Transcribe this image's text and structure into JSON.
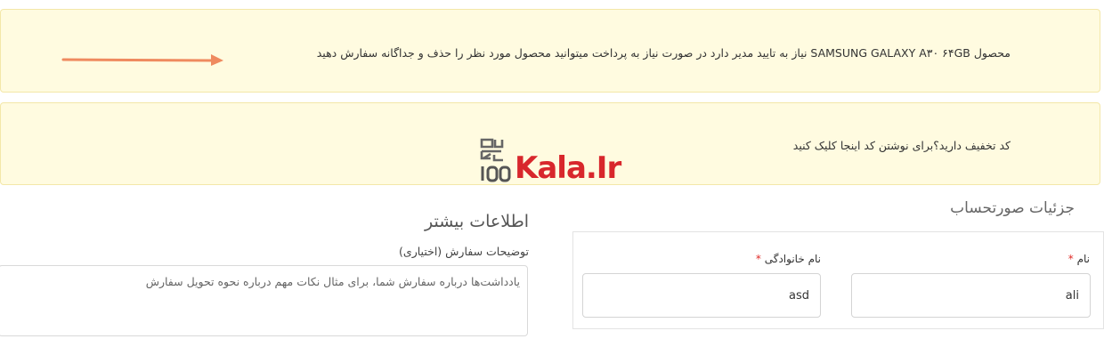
{
  "notices": {
    "approval": "محصول SAMSUNG GALAXY A۳۰ ۶۴GB نیاز به تایید مدیر دارد در صورت نیاز به پرداخت میتوانید محصول مورد نظر را حذف و جداگانه سفارش دهید",
    "coupon_question": "کد تخفیف دارید؟",
    "coupon_link": "برای نوشتن کد اینجا کلیک کنید"
  },
  "logo": {
    "top_mark": "صد کالا",
    "number": "100",
    "word": "Kala.Ir",
    "brand_color": "#d8272c"
  },
  "billing": {
    "title": "جزئیات صورتحساب",
    "first_name_label": "نام",
    "last_name_label": "نام خانوادگی",
    "required_mark": "*",
    "first_name_value": "ali",
    "last_name_value": "asd"
  },
  "additional": {
    "title": "اطلاعات بیشتر",
    "notes_label": "توضیحات سفارش (اختیاری)",
    "notes_placeholder": "یادداشت‌ها درباره سفارش شما، برای مثال نکات مهم درباره نحوه تحویل سفارش"
  },
  "colors": {
    "notice_bg": "#fffbe0",
    "required": "#e02b27",
    "arrow": "#ef8a5f"
  }
}
